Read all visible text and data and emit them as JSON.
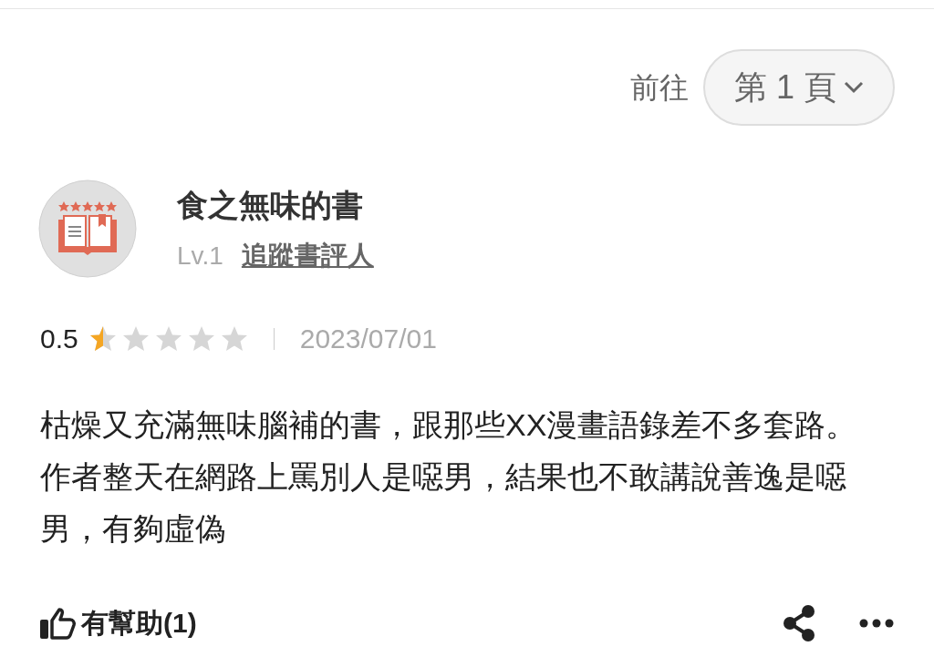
{
  "pager": {
    "label": "前往",
    "page": "第 1 頁"
  },
  "review": {
    "author": "食之無味的書",
    "level": "Lv.1",
    "follow": "追蹤書評人",
    "score": "0.5",
    "stars": 0.5,
    "date": "2023/07/01",
    "text": "枯燥又充滿無味腦補的書，跟那些XX漫畫語錄差不多套路。作者整天在網路上罵別人是噁男，結果也不敢講說善逸是噁男，有夠虛偽",
    "helpful": "有幫助(1)"
  }
}
